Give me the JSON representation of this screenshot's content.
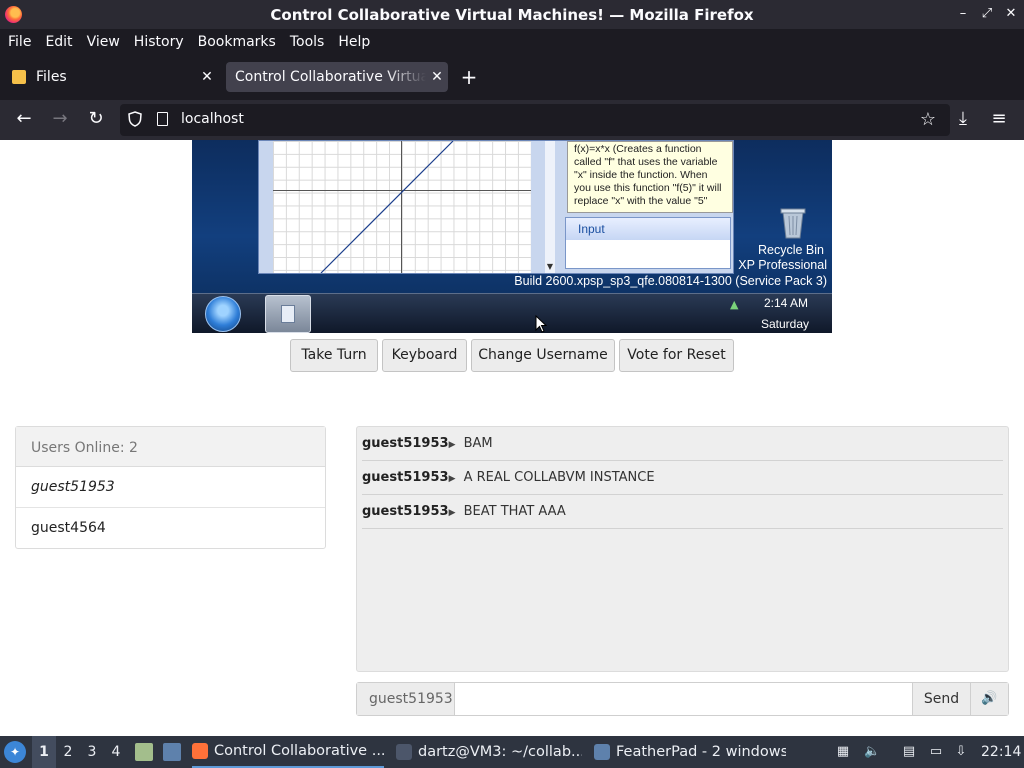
{
  "window": {
    "title": "Control Collaborative Virtual Machines! — Mozilla Firefox",
    "controls": [
      "–",
      "⤢",
      "✕"
    ]
  },
  "menu": [
    "File",
    "Edit",
    "View",
    "History",
    "Bookmarks",
    "Tools",
    "Help"
  ],
  "tabs": [
    {
      "label": "Files",
      "active": false
    },
    {
      "label": "Control Collaborative Virtual Machines!",
      "active": true
    }
  ],
  "newtab_label": "+",
  "address": {
    "url": "localhost"
  },
  "vm": {
    "help_text": "f(x)=x*x  (Creates a function called \"f\" that uses the variable \"x\" inside the function. When you use this function \"f(5)\" it will replace \"x\" with the value \"5\"",
    "input_header": "Input",
    "recycle_bin": "Recycle Bin",
    "os_name": "XP Professional",
    "build": "Build 2600.xpsp_sp3_qfe.080814-1300 (Service Pack 3)",
    "clock_time": "2:14 AM",
    "clock_day": "Saturday"
  },
  "controls": {
    "take_turn": "Take Turn",
    "keyboard": "Keyboard",
    "change_username": "Change Username",
    "vote_reset": "Vote for Reset"
  },
  "users": {
    "header": "Users Online: 2",
    "list": [
      "guest51953",
      "guest4564"
    ]
  },
  "chat": {
    "arrow": "▶",
    "messages": [
      {
        "user": "guest51953",
        "text": "BAM"
      },
      {
        "user": "guest51953",
        "text": "A REAL COLLABVM INSTANCE"
      },
      {
        "user": "guest51953",
        "text": "BEAT THAT AAA"
      }
    ],
    "username": "guest51953",
    "input_value": "",
    "send": "Send",
    "speaker": "🔊"
  },
  "taskbar": {
    "workspaces": [
      "1",
      "2",
      "3",
      "4"
    ],
    "tasks": [
      {
        "label": "Control Collaborative ...",
        "color": "#ff7139"
      },
      {
        "label": "dartz@VM3: ~/collab...",
        "color": "#4c566a"
      },
      {
        "label": "FeatherPad - 2 windows",
        "color": "#5e81ac"
      }
    ],
    "clock": "22:14"
  },
  "colors": {
    "firefox_chrome": "#2b2a33",
    "vm_desktop": "#123f7e",
    "taskbar": "#2e3440"
  }
}
